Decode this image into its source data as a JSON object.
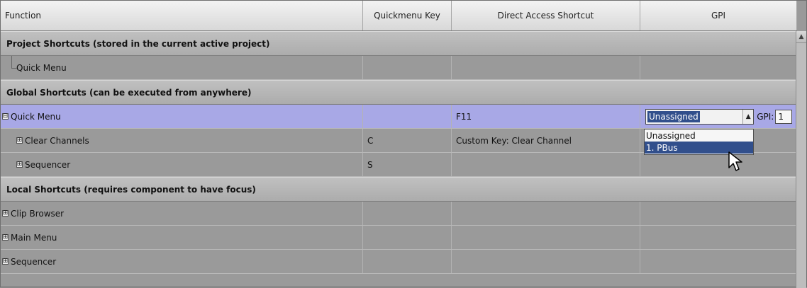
{
  "headers": {
    "function": "Function",
    "quickmenu_key": "Quickmenu Key",
    "direct_access_shortcut": "Direct Access Shortcut",
    "gpi": "GPI"
  },
  "sections": [
    {
      "title": "Project Shortcuts (stored in the current active project)"
    },
    {
      "title": "Global Shortcuts (can be executed from anywhere)"
    },
    {
      "title": "Local Shortcuts (requires component to have focus)"
    }
  ],
  "rows": {
    "project_quick_menu": {
      "function": "Quick Menu",
      "quickmenu_key": "",
      "direct_access_shortcut": "",
      "gpi": ""
    },
    "global_quick_menu": {
      "function": "Quick Menu",
      "quickmenu_key": "",
      "direct_access_shortcut": "F11",
      "gpi_selected": "Unassigned",
      "gpi_label": "GPI:",
      "gpi_value": "1",
      "expander": "⊟"
    },
    "clear_channels": {
      "function": "Clear Channels",
      "quickmenu_key": "C",
      "direct_access_shortcut": "Custom Key: Clear Channel",
      "gpi": "",
      "expander": "⊞"
    },
    "sequencer_global": {
      "function": "Sequencer",
      "quickmenu_key": "S",
      "direct_access_shortcut": "",
      "gpi": "",
      "expander": "⊞"
    },
    "clip_browser": {
      "function": "Clip Browser",
      "quickmenu_key": "",
      "direct_access_shortcut": "",
      "gpi": "",
      "expander": "⊞"
    },
    "main_menu": {
      "function": "Main Menu",
      "quickmenu_key": "",
      "direct_access_shortcut": "",
      "gpi": "",
      "expander": "⊞"
    },
    "sequencer_local": {
      "function": "Sequencer",
      "quickmenu_key": "",
      "direct_access_shortcut": "",
      "gpi": "",
      "expander": "⊞"
    }
  },
  "dropdown": {
    "options": [
      "Unassigned",
      "1. PBus"
    ],
    "highlighted": "1. PBus"
  },
  "icons": {
    "scroll_up": "scroll-up-icon",
    "combo_arrow": "dropdown-arrow-icon",
    "cursor": "mouse-pointer-icon"
  },
  "colors": {
    "selected_row": "#a8a8e6",
    "selection_highlight": "#314f8c",
    "grid_background": "#9a9a9a",
    "section_background": "#b4b4b4"
  }
}
